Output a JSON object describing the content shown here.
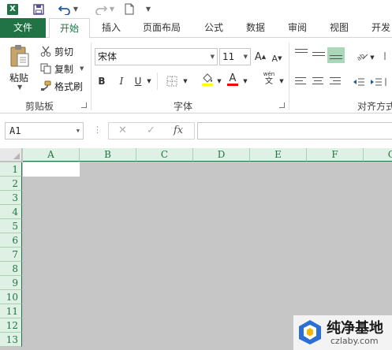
{
  "app": {
    "icon_letter": "X"
  },
  "qat": {
    "icons": [
      "excel-logo-icon",
      "save-icon",
      "undo-icon",
      "redo-icon",
      "new-document-icon",
      "customize-dropdown-icon"
    ]
  },
  "tabs": [
    {
      "label": "文件"
    },
    {
      "label": "开始"
    },
    {
      "label": "插入"
    },
    {
      "label": "页面布局"
    },
    {
      "label": "公式"
    },
    {
      "label": "数据"
    },
    {
      "label": "审阅"
    },
    {
      "label": "视图"
    },
    {
      "label": "开发"
    }
  ],
  "ribbon": {
    "clipboard": {
      "paste_label": "粘贴",
      "cut_label": "剪切",
      "copy_label": "复制",
      "format_painter_label": "格式刷",
      "group_label": "剪贴板"
    },
    "font": {
      "font_name": "宋体",
      "font_size": "11",
      "bold": "B",
      "italic": "I",
      "underline": "U",
      "increase_size": "A",
      "decrease_size": "A",
      "font_color_letter": "A",
      "phonetic_top": "wén",
      "phonetic_bottom": "文",
      "group_label": "字体",
      "font_color": "#ff0000"
    },
    "alignment": {
      "group_label": "对齐方式"
    }
  },
  "formula_bar": {
    "name_box": "A1",
    "cancel_symbol": "✕",
    "enter_symbol": "✓",
    "fx_symbol": "fx",
    "formula": ""
  },
  "grid": {
    "columns": [
      "A",
      "B",
      "C",
      "D",
      "E",
      "F",
      "G"
    ],
    "rows": [
      "1",
      "2",
      "3",
      "4",
      "5",
      "6",
      "7",
      "8",
      "9",
      "10",
      "11",
      "12",
      "13"
    ],
    "selected_cell": "A1"
  },
  "watermark": {
    "title": "纯净基地",
    "url": "czlaby.com"
  },
  "colors": {
    "excel_green": "#217346",
    "header_bg": "#dff0e4",
    "sheet_gray": "#c6c6c6"
  }
}
